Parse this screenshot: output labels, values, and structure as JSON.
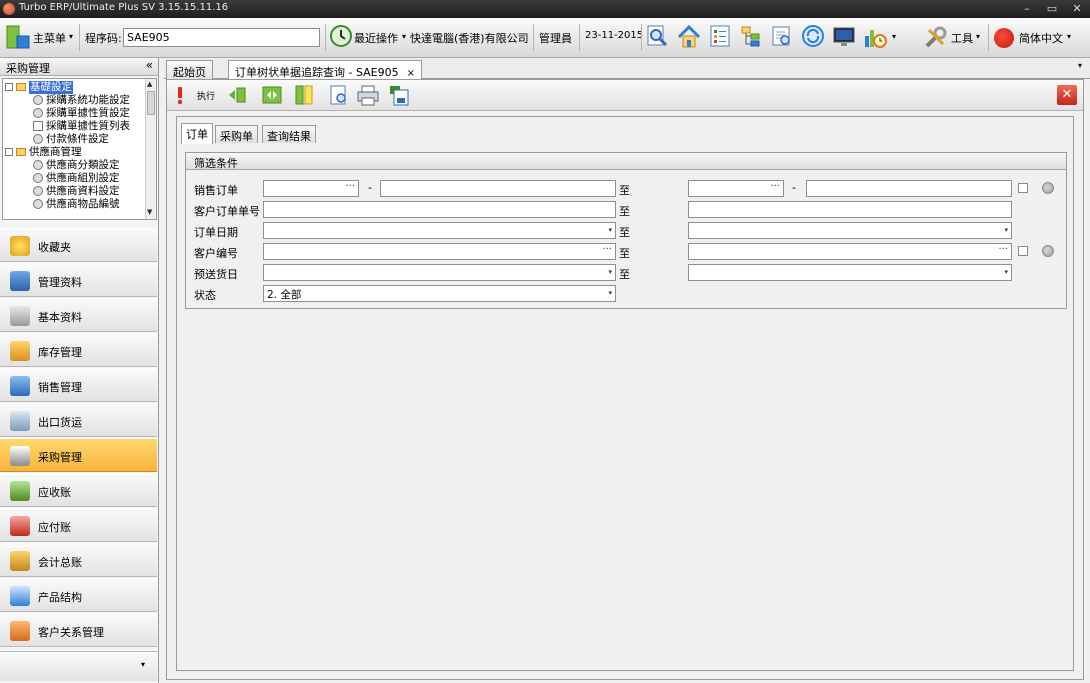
{
  "window": {
    "title": "Turbo ERP/Ultimate Plus SV 3.15.15.11.16",
    "min": "–",
    "max": "▭",
    "close": "✕"
  },
  "toolbar": {
    "main_menu": "主菜单",
    "program_code_label": "程序码:",
    "program_code_value": "SAE905",
    "recent_ops": "最近操作",
    "company": "快達電腦(香港)有限公司",
    "user": "管理員",
    "date": "23-11-2015",
    "tools": "工具",
    "language": "简体中文",
    "dropdown_arrow": "▾"
  },
  "sidebar": {
    "title": "采购管理",
    "collapse": "«",
    "tree": [
      "基礎設定",
      "採購系統功能設定",
      "採購單據性質設定",
      "採購單據性質列表",
      "付款條件設定",
      "供應商管理",
      "供應商分類設定",
      "供應商組別設定",
      "供應商資料設定",
      "供應商物品編號"
    ],
    "nav": [
      "收藏夹",
      "管理资料",
      "基本资料",
      "库存管理",
      "销售管理",
      "出口货运",
      "采购管理",
      "应收账",
      "应付账",
      "会计总账",
      "产品结构",
      "客户关系管理"
    ],
    "footer_arrow": "▾"
  },
  "tabs": {
    "items": [
      "起始页",
      "订单树状单据追踪查询 - SAE905"
    ],
    "close": "×",
    "menu_arrow": "▾"
  },
  "subtoolbar": {
    "execute": "执行",
    "close": "✕"
  },
  "inner_tabs": [
    "订单",
    "采购单",
    "查询结果"
  ],
  "filter": {
    "title": "筛选条件",
    "labels": [
      "销售订单",
      "客户订单单号",
      "订单日期",
      "客户编号",
      "预送货日",
      "状态"
    ],
    "to": "至",
    "dash": "-",
    "ellipsis": "···",
    "dd": "▾",
    "status_value": "2. 全部"
  }
}
